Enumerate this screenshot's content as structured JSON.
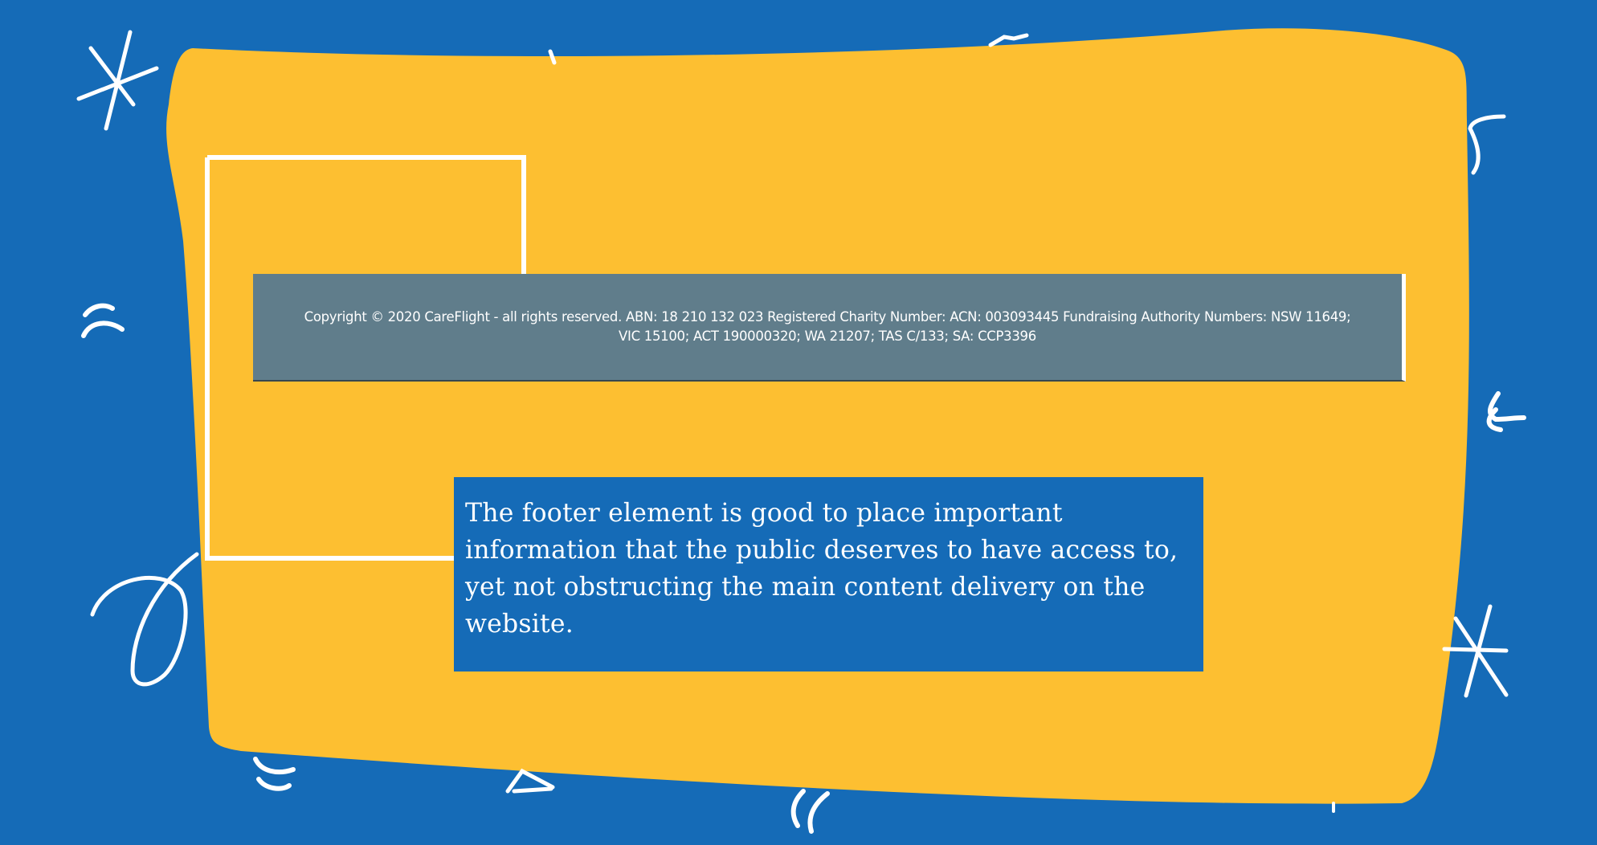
{
  "colors": {
    "background": "#156BB7",
    "card": "#FDBF31",
    "footer_bar": "#607D8B",
    "caption_box": "#156BB7",
    "stroke": "#FFFFFF"
  },
  "footer": {
    "copyright_text": "Copyright © 2020 CareFlight - all rights reserved. ABN: 18 210 132 023 Registered Charity Number: ACN: 003093445 Fundraising Authority Numbers: NSW 11649; VIC 15100; ACT 190000320; WA 21207; TAS C/133; SA: CCP3396"
  },
  "caption": {
    "text": "The footer element is good to place important information that the public deserves to have access to, yet not obstructing the main content delivery on the website."
  }
}
